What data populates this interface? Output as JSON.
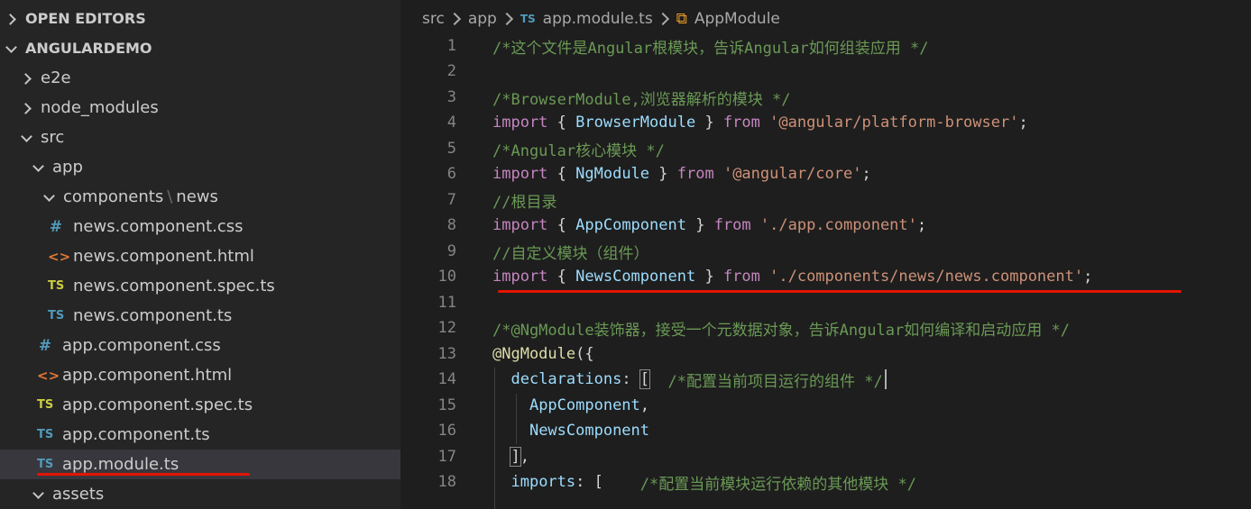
{
  "sidebar": {
    "open_editors": "OPEN EDITORS",
    "project": "ANGULARDEMO",
    "tree": [
      {
        "label": "e2e"
      },
      {
        "label": "node_modules"
      },
      {
        "label": "src"
      },
      {
        "label": "app"
      },
      {
        "label_a": "components",
        "label_b": "news"
      },
      {
        "label": "news.component.css"
      },
      {
        "label": "news.component.html"
      },
      {
        "label": "news.component.spec.ts"
      },
      {
        "label": "news.component.ts"
      },
      {
        "label": "app.component.css"
      },
      {
        "label": "app.component.html"
      },
      {
        "label": "app.component.spec.ts"
      },
      {
        "label": "app.component.ts"
      },
      {
        "label": "app.module.ts"
      },
      {
        "label": "assets"
      }
    ],
    "icons": {
      "css": "#",
      "html": "<>",
      "ts": "TS"
    }
  },
  "breadcrumb": {
    "items": [
      "src",
      "app",
      "app.module.ts",
      "AppModule"
    ]
  },
  "code": {
    "line_numbers": [
      "1",
      "2",
      "3",
      "4",
      "5",
      "6",
      "7",
      "8",
      "9",
      "10",
      "11",
      "12",
      "13",
      "14",
      "15",
      "16",
      "17",
      "18"
    ],
    "l1": "/*这个文件是Angular根模块，告诉Angular如何组装应用 */",
    "l3": "/*BrowserModule,浏览器解析的模块 */",
    "l5": "/*Angular核心模块 */",
    "l7": "//根目录",
    "l9": "//自定义模块（组件）",
    "l12": "/*@NgModule装饰器，接受一个元数据对象，告诉Angular如何编译和启动应用 */",
    "l14_comment": "/*配置当前项目运行的组件 */",
    "l18_comment": "/*配置当前模块运行依赖的其他模块 */",
    "kw_import": "import",
    "kw_from": "from",
    "browser_module": "BrowserModule",
    "ng_module": "NgModule",
    "app_component": "AppComponent",
    "news_component": "NewsComponent",
    "str_platform": "'@angular/platform-browser'",
    "str_core": "'@angular/core'",
    "str_app": "'./app.component'",
    "str_news": "'./components/news/news.component'",
    "decorator": "@NgModule",
    "declarations": "declarations",
    "imports": "imports"
  }
}
